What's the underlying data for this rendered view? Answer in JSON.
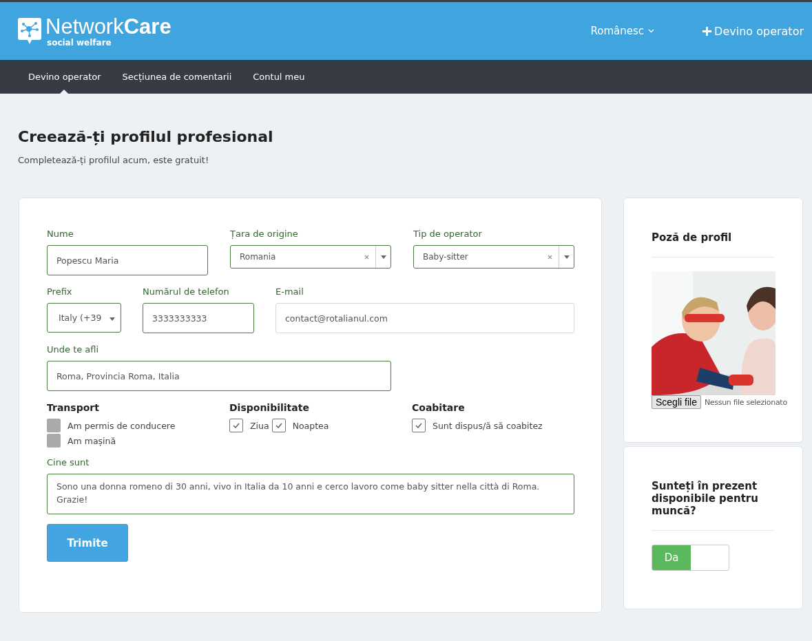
{
  "header": {
    "logo": {
      "name_light": "Network",
      "name_bold": "Care",
      "tagline": "social welfare"
    },
    "language": "Românesc",
    "cta": "Devino operator"
  },
  "nav": [
    {
      "label": "Devino operator",
      "selected": true
    },
    {
      "label": "Secțiunea de comentarii",
      "selected": false
    },
    {
      "label": "Contul meu",
      "selected": false
    }
  ],
  "page": {
    "title": "Creează-ți profilul profesional",
    "subtitle": "Completează-ți profilul acum, este gratuit!"
  },
  "form": {
    "rows": [
      [
        {
          "kind": "input",
          "label": "Nume",
          "value": "Popescu Maria",
          "validated": true
        },
        {
          "kind": "select2",
          "label": "Țara de origine",
          "value": "Romania",
          "validated": true
        },
        {
          "kind": "select2",
          "label": "Tip de operator",
          "value": "Baby-sitter",
          "validated": true
        }
      ],
      [
        {
          "kind": "select",
          "label": "Prefix",
          "value": "Italy (+39",
          "validated": true
        },
        {
          "kind": "input",
          "label": "Numărul de telefon",
          "value": "3333333333",
          "validated": true
        },
        {
          "kind": "input",
          "label": "E-mail",
          "value": "contact@rotalianul.com",
          "validated": false
        }
      ],
      [
        {
          "kind": "input",
          "label": "Unde te afli",
          "value": "Roma, Provincia Roma, Italia",
          "validated": true
        }
      ]
    ],
    "groups": [
      {
        "title": "Transport",
        "options": [
          {
            "label": "Am permis de conducere",
            "checked": false
          },
          {
            "label": "Am mașină",
            "checked": false
          }
        ]
      },
      {
        "title": "Disponibilitate",
        "options": [
          {
            "label": "Ziua",
            "checked": true
          },
          {
            "label": "Noaptea",
            "checked": true
          }
        ]
      },
      {
        "title": "Coabitare",
        "options": [
          {
            "label": "Sunt dispus/ă să coabitez",
            "checked": true
          }
        ]
      }
    ],
    "about": {
      "label": "Cine sunt",
      "value": "Sono una donna romeno di 30 anni, vivo in Italia da 10 anni e cerco lavoro come baby sitter nella città di Roma. Grazie!",
      "validated": true
    },
    "submit": "Trimite"
  },
  "photo_card": {
    "title": "Poză de profil",
    "file_button": "Scegli file",
    "file_status": "Nessun file selezionato"
  },
  "availability_card": {
    "title": "Sunteți în prezent disponibile pentru muncă?",
    "toggle": {
      "label": "Da",
      "on": true
    }
  }
}
